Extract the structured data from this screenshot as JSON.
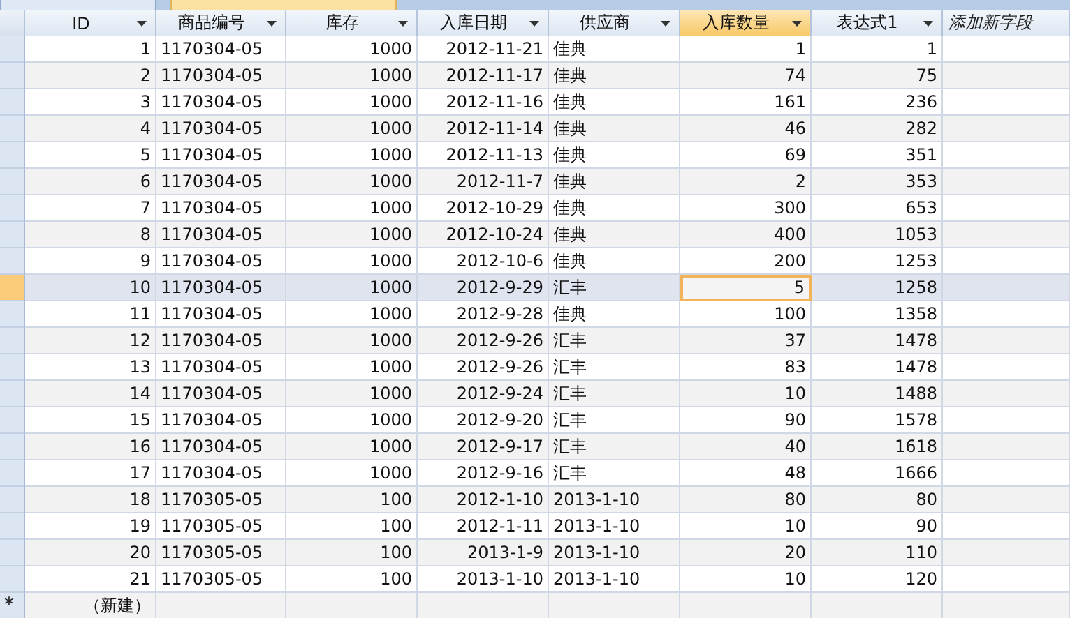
{
  "document_tabs": [
    {
      "selected": false
    },
    {
      "selected": true
    }
  ],
  "columns": [
    {
      "label": "ID",
      "kind": "number",
      "selected": false
    },
    {
      "label": "商品编号",
      "kind": "text",
      "selected": false
    },
    {
      "label": "库存",
      "kind": "number",
      "selected": false
    },
    {
      "label": "入库日期",
      "kind": "date",
      "selected": false
    },
    {
      "label": "供应商",
      "kind": "text",
      "selected": false
    },
    {
      "label": "入库数量",
      "kind": "number",
      "selected": true
    },
    {
      "label": "表达式1",
      "kind": "number",
      "selected": false
    }
  ],
  "add_field": {
    "label": "添加新字段"
  },
  "rows": [
    {
      "selected": false,
      "cells": [
        "1",
        "1170304-05",
        "1000",
        "2012-11-21",
        "佳典",
        "1",
        "1"
      ]
    },
    {
      "selected": false,
      "cells": [
        "2",
        "1170304-05",
        "1000",
        "2012-11-17",
        "佳典",
        "74",
        "75"
      ]
    },
    {
      "selected": false,
      "cells": [
        "3",
        "1170304-05",
        "1000",
        "2012-11-16",
        "佳典",
        "161",
        "236"
      ]
    },
    {
      "selected": false,
      "cells": [
        "4",
        "1170304-05",
        "1000",
        "2012-11-14",
        "佳典",
        "46",
        "282"
      ]
    },
    {
      "selected": false,
      "cells": [
        "5",
        "1170304-05",
        "1000",
        "2012-11-13",
        "佳典",
        "69",
        "351"
      ]
    },
    {
      "selected": false,
      "cells": [
        "6",
        "1170304-05",
        "1000",
        "2012-11-7",
        "佳典",
        "2",
        "353"
      ]
    },
    {
      "selected": false,
      "cells": [
        "7",
        "1170304-05",
        "1000",
        "2012-10-29",
        "佳典",
        "300",
        "653"
      ]
    },
    {
      "selected": false,
      "cells": [
        "8",
        "1170304-05",
        "1000",
        "2012-10-24",
        "佳典",
        "400",
        "1053"
      ]
    },
    {
      "selected": false,
      "cells": [
        "9",
        "1170304-05",
        "1000",
        "2012-10-6",
        "佳典",
        "200",
        "1253"
      ]
    },
    {
      "selected": true,
      "cells": [
        "10",
        "1170304-05",
        "1000",
        "2012-9-29",
        "汇丰",
        "5",
        "1258"
      ]
    },
    {
      "selected": false,
      "cells": [
        "11",
        "1170304-05",
        "1000",
        "2012-9-28",
        "佳典",
        "100",
        "1358"
      ]
    },
    {
      "selected": false,
      "cells": [
        "12",
        "1170304-05",
        "1000",
        "2012-9-26",
        "汇丰",
        "37",
        "1478"
      ]
    },
    {
      "selected": false,
      "cells": [
        "13",
        "1170304-05",
        "1000",
        "2012-9-26",
        "汇丰",
        "83",
        "1478"
      ]
    },
    {
      "selected": false,
      "cells": [
        "14",
        "1170304-05",
        "1000",
        "2012-9-24",
        "汇丰",
        "10",
        "1488"
      ]
    },
    {
      "selected": false,
      "cells": [
        "15",
        "1170304-05",
        "1000",
        "2012-9-20",
        "汇丰",
        "90",
        "1578"
      ]
    },
    {
      "selected": false,
      "cells": [
        "16",
        "1170304-05",
        "1000",
        "2012-9-17",
        "汇丰",
        "40",
        "1618"
      ]
    },
    {
      "selected": false,
      "cells": [
        "17",
        "1170304-05",
        "1000",
        "2012-9-16",
        "汇丰",
        "48",
        "1666"
      ]
    },
    {
      "selected": false,
      "cells": [
        "18",
        "1170305-05",
        "100",
        "2012-1-10",
        "2013-1-10",
        "80",
        "80"
      ]
    },
    {
      "selected": false,
      "cells": [
        "19",
        "1170305-05",
        "100",
        "2012-1-11",
        "2013-1-10",
        "10",
        "90"
      ]
    },
    {
      "selected": false,
      "cells": [
        "20",
        "1170305-05",
        "100",
        "2013-1-9",
        "2013-1-10",
        "20",
        "110"
      ]
    },
    {
      "selected": false,
      "cells": [
        "21",
        "1170305-05",
        "100",
        "2013-1-10",
        "2013-1-10",
        "10",
        "120"
      ]
    }
  ],
  "new_row": {
    "marker": "*",
    "label": "（新建）"
  }
}
